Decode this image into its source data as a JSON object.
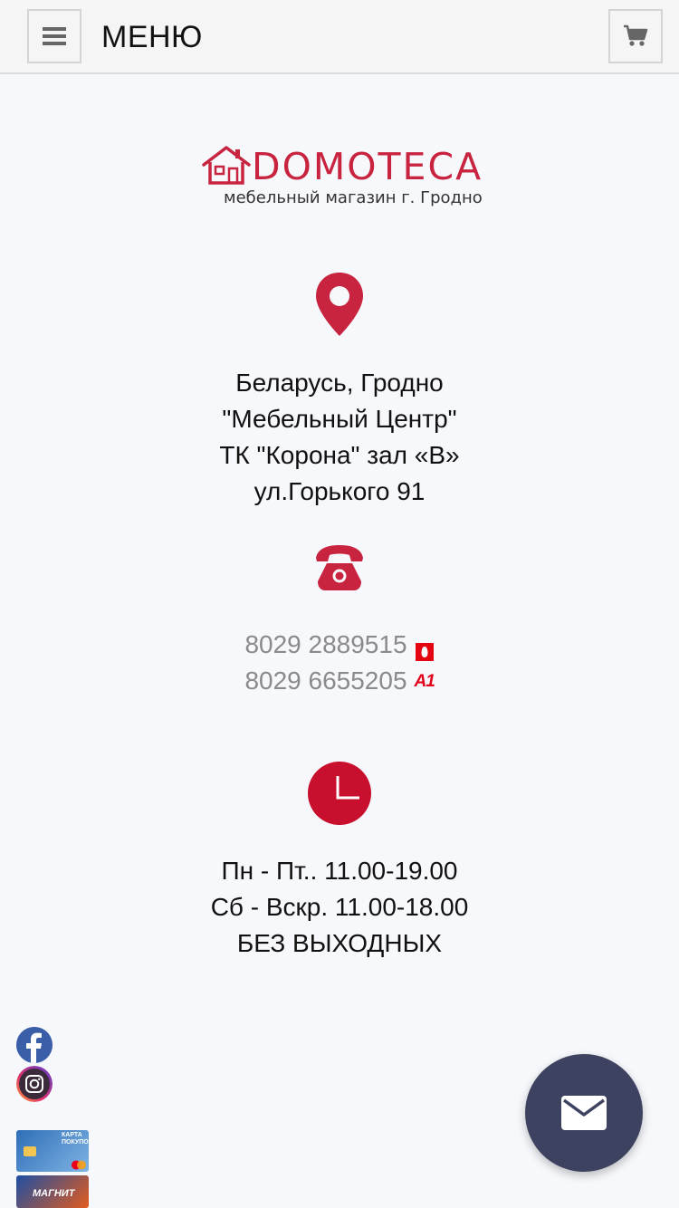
{
  "header": {
    "menu_label": "МЕНЮ",
    "menu_icon": "hamburger-icon",
    "cart_icon": "cart-icon"
  },
  "logo": {
    "name": "DOMOTECA",
    "subtitle": "мебельный магазин г. Гродно",
    "icon": "house-icon"
  },
  "address": {
    "icon": "map-pin-icon",
    "lines": [
      "Беларусь, Гродно",
      "\"Мебельный Центр\"",
      "ТК \"Корона\" зал «В»",
      "ул.Горького 91"
    ]
  },
  "phones": {
    "icon": "telephone-icon",
    "items": [
      {
        "number": "8029 2889515",
        "operator_icon": "mts-icon"
      },
      {
        "number": "8029 6655205",
        "operator_icon": "a1-icon",
        "operator_label": "A1"
      }
    ]
  },
  "hours": {
    "icon": "clock-icon",
    "lines": [
      "Пн - Пт.. 11.00-19.00",
      "Сб - Вскр. 11.00-18.00",
      "БЕЗ ВЫХОДНЫХ"
    ]
  },
  "social": {
    "items": [
      {
        "icon": "facebook-icon"
      },
      {
        "icon": "instagram-icon"
      }
    ]
  },
  "cards": {
    "items": [
      {
        "label": "КАРТА ПОКУПОК"
      },
      {
        "label": "МАГНИТ"
      }
    ]
  },
  "chat": {
    "icon": "envelope-icon"
  },
  "colors": {
    "accent": "#c8233f",
    "chat_bg": "#3c4260",
    "background": "#f7f8fc"
  }
}
